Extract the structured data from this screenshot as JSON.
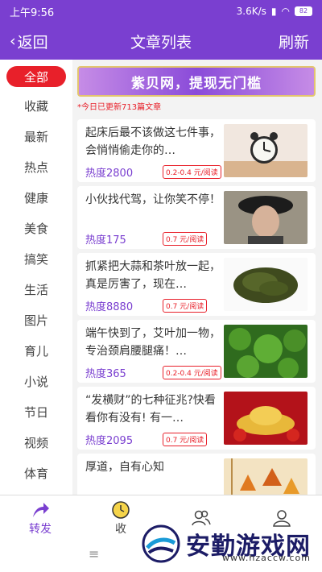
{
  "status": {
    "time": "上午9:56",
    "speed": "3.6K/s",
    "battery": "82"
  },
  "header": {
    "back_label": "返回",
    "title": "文章列表",
    "refresh_label": "刷新"
  },
  "sidebar": {
    "items": [
      {
        "label": "全部"
      },
      {
        "label": "收藏"
      },
      {
        "label": "最新"
      },
      {
        "label": "热点"
      },
      {
        "label": "健康"
      },
      {
        "label": "美食"
      },
      {
        "label": "搞笑"
      },
      {
        "label": "生活"
      },
      {
        "label": "图片"
      },
      {
        "label": "育儿"
      },
      {
        "label": "小说"
      },
      {
        "label": "节日"
      },
      {
        "label": "视频"
      },
      {
        "label": "体育"
      }
    ]
  },
  "banner": {
    "text": "紫贝网，提现无门槛"
  },
  "notice": "*今日已更新713篇文章",
  "articles": [
    {
      "title": "起床后最不该做这七件事，会悄悄偷走你的…",
      "heat": "热度2800",
      "reward": "0.2-0.4 元/阅读",
      "thumb": "alarm-clock-image"
    },
    {
      "title": "小伙找代驾，让你笑不停！",
      "heat": "热度175",
      "reward": "0.7 元/阅读",
      "thumb": "woman-hat-image"
    },
    {
      "title": "抓紧把大蒜和茶叶放一起，真是厉害了，现在…",
      "heat": "热度8880",
      "reward": "0.7 元/阅读",
      "thumb": "tea-leaves-image"
    },
    {
      "title": "端午快到了，艾叶加一物，专治颈肩腰腿痛！…",
      "heat": "热度365",
      "reward": "0.2-0.4 元/阅读",
      "thumb": "mugwort-image"
    },
    {
      "title": "“发横财”的七种征兆?快看看你有没有! 有一…",
      "heat": "热度2095",
      "reward": "0.7 元/阅读",
      "thumb": "gold-ingot-image"
    },
    {
      "title": "厚道，自有心知",
      "heat": "",
      "reward": "",
      "thumb": "autumn-leaves-image"
    }
  ],
  "bottomnav": [
    {
      "label": "转发",
      "icon": "share-icon"
    },
    {
      "label": "收",
      "icon": "clock-icon"
    },
    {
      "label": "",
      "icon": "users-icon"
    },
    {
      "label": "",
      "icon": "profile-icon"
    }
  ],
  "watermark": {
    "text": "安勤游戏网",
    "url": "www.hzaccw.com"
  },
  "colors": {
    "accent": "#7a3fd0",
    "red": "#e8202a"
  }
}
